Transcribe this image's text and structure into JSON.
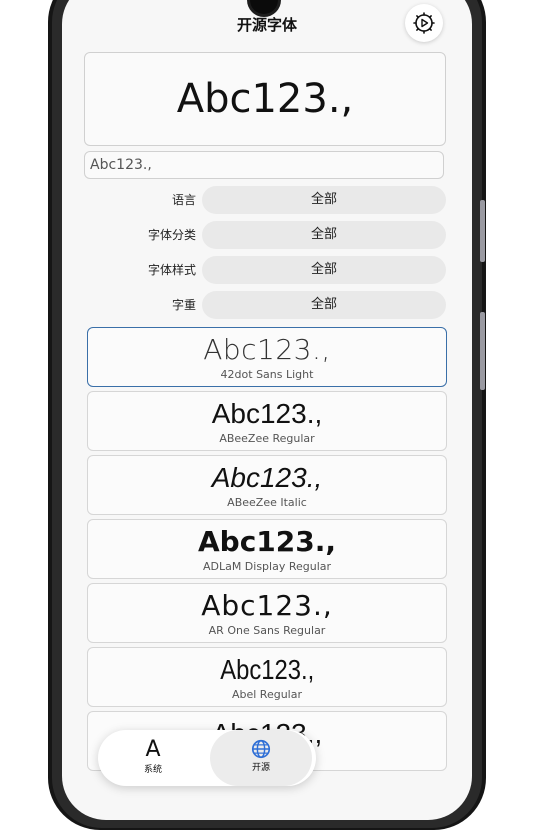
{
  "app": {
    "title": "开源字体"
  },
  "preview": {
    "sample_text": "Abc123.,"
  },
  "input": {
    "value": "Abc123.,"
  },
  "filters": [
    {
      "label": "语言",
      "value": "全部"
    },
    {
      "label": "字体分类",
      "value": "全部"
    },
    {
      "label": "字体样式",
      "value": "全部"
    },
    {
      "label": "字重",
      "value": "全部"
    }
  ],
  "fonts": [
    {
      "sample": "Abc123.,",
      "name": "42dot Sans Light",
      "selected": true
    },
    {
      "sample": "Abc123.,",
      "name": "ABeeZee Regular"
    },
    {
      "sample": "Abc123.,",
      "name": "ABeeZee Italic"
    },
    {
      "sample": "Abc123.,",
      "name": "ADLaM Display Regular"
    },
    {
      "sample": "Abc123.,",
      "name": "AR One Sans Regular"
    },
    {
      "sample": "Abc123.,",
      "name": "Abel Regular"
    },
    {
      "sample": "Abc123.,",
      "name": ""
    }
  ],
  "nav": {
    "system": {
      "icon_text": "A",
      "label": "系统"
    },
    "open_source": {
      "label": "开源"
    }
  },
  "icons": {
    "settings": "gear-icon",
    "open_source": "globe-icon"
  },
  "colors": {
    "accent_border": "#3a6fa8",
    "pill_bg": "#e9e9e9",
    "screen_bg": "#f7f7f7"
  }
}
